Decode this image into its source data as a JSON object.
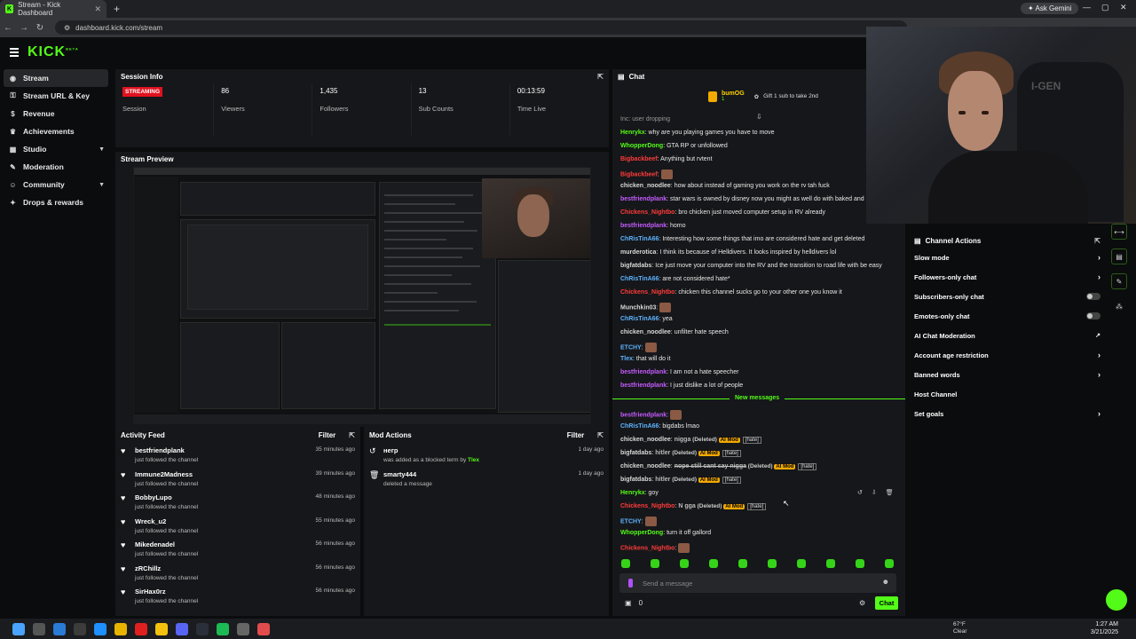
{
  "browser": {
    "tab_title": "Stream - Kick Dashboard",
    "url": "dashboard.kick.com/stream",
    "gemini": "Ask Gemini"
  },
  "brand": {
    "logo": "KICK",
    "beta": "BETA",
    "accent": "#53fc18"
  },
  "sidebar": {
    "items": [
      {
        "label": "Stream",
        "icon": "broadcast-icon"
      },
      {
        "label": "Stream URL & Key",
        "icon": "key-icon"
      },
      {
        "label": "Revenue",
        "icon": "dollar-icon"
      },
      {
        "label": "Achievements",
        "icon": "trophy-icon"
      },
      {
        "label": "Studio",
        "icon": "grid-icon"
      },
      {
        "label": "Moderation",
        "icon": "wrench-icon"
      },
      {
        "label": "Community",
        "icon": "people-icon"
      },
      {
        "label": "Drops & rewards",
        "icon": "gift-icon"
      }
    ]
  },
  "session": {
    "title": "Session Info",
    "status": "STREAMING",
    "stats": [
      {
        "value": "",
        "label": "Session"
      },
      {
        "value": "86",
        "label": "Viewers"
      },
      {
        "value": "1,435",
        "label": "Followers"
      },
      {
        "value": "13",
        "label": "Sub Counts"
      },
      {
        "value": "00:13:59",
        "label": "Time Live"
      }
    ]
  },
  "preview": {
    "title": "Stream Preview"
  },
  "activity": {
    "title": "Activity Feed",
    "filter": "Filter",
    "items": [
      {
        "name": "bestfriendplank",
        "sub": "just followed the channel",
        "time": "35 minutes ago"
      },
      {
        "name": "Immune2Madness",
        "sub": "just followed the channel",
        "time": "39 minutes ago"
      },
      {
        "name": "BobbyLupo",
        "sub": "just followed the channel",
        "time": "48 minutes ago"
      },
      {
        "name": "Wreck_u2",
        "sub": "just followed the channel",
        "time": "55 minutes ago"
      },
      {
        "name": "Mikedenadel",
        "sub": "just followed the channel",
        "time": "56 minutes ago"
      },
      {
        "name": "zRChillz",
        "sub": "just followed the channel",
        "time": "56 minutes ago"
      },
      {
        "name": "SirHax0rz",
        "sub": "just followed the channel",
        "time": "56 minutes ago"
      }
    ]
  },
  "mod": {
    "title": "Mod Actions",
    "filter": "Filter",
    "items": [
      {
        "name": "негр",
        "sub_pre": "was added as a blocked term by",
        "by": "Tlex",
        "time": "1 day ago"
      },
      {
        "name": "smarty444",
        "sub_pre": "deleted a message",
        "by": "",
        "time": "1 day ago"
      }
    ]
  },
  "chat": {
    "title": "Chat",
    "top_user": "bumOG",
    "top_count": "1",
    "gift": "Gift 1 sub to take 2nd",
    "partial": "Inc: user dropping",
    "messages": [
      {
        "user": "Henrykx",
        "cls": "u-g",
        "text": "why are you playing games you have to move"
      },
      {
        "user": "WhopperDong",
        "cls": "u-g",
        "text": "GTA RP or unfollowed"
      },
      {
        "user": "Bigbackbeef",
        "cls": "u-r",
        "text": "Anything but rvtent"
      },
      {
        "user": "Bigbackbeef",
        "cls": "u-r",
        "text": ""
      },
      {
        "user": "chicken_noodlee",
        "cls": "u-w",
        "text": "how about instead of gaming you work on the rv tah fuck"
      },
      {
        "user": "bestfriendplank",
        "cls": "u-p",
        "text": "star wars is owned by disney now you might as well do with baked and b"
      },
      {
        "user": "Chickens_Nightbo",
        "cls": "u-r",
        "text": "bro chicken just moved computer setup in RV already"
      },
      {
        "user": "bestfriendplank",
        "cls": "u-p",
        "text": "homo"
      },
      {
        "user": "ChRisTinA66",
        "cls": "u-b",
        "text": "Interesting how some things that imo are considered hate and get deleted"
      },
      {
        "user": "murderotica",
        "cls": "u-w",
        "text": "I think its because of Helldivers. It looks inspired by helldivers lol"
      },
      {
        "user": "bigfatdabs",
        "cls": "u-w",
        "text": "Ice just move your computer into the RV and the transition to road life with be easy"
      },
      {
        "user": "ChRisTinA66",
        "cls": "u-b",
        "text": "are not considered hate*"
      },
      {
        "user": "Chickens_Nightbo",
        "cls": "u-r",
        "text": "chicken this channel sucks go to your other one you know it"
      },
      {
        "user": "Munchkin03",
        "cls": "u-w",
        "text": ""
      },
      {
        "user": "ChRisTinA66",
        "cls": "u-b",
        "text": "yea"
      },
      {
        "user": "chicken_noodlee",
        "cls": "u-w",
        "text": "unfilter hate speech"
      },
      {
        "user": "ETCHY",
        "cls": "u-b",
        "text": ""
      },
      {
        "user": "Tlex",
        "cls": "u-b",
        "text": "that will do it"
      },
      {
        "user": "bestfriendplank",
        "cls": "u-p",
        "text": "I am not a hate speecher"
      },
      {
        "user": "bestfriendplank",
        "cls": "u-p",
        "text": "I just dislike a lot of people"
      }
    ],
    "new_label": "New messages",
    "new_messages": [
      {
        "user": "bestfriendplank",
        "cls": "u-p",
        "text": ""
      },
      {
        "user": "ChRisTinA66",
        "cls": "u-b",
        "text": "bigdabs lmao"
      },
      {
        "user": "chicken_noodlee",
        "cls": "u-w",
        "text": "nigga",
        "deleted": true
      },
      {
        "user": "bigfatdabs",
        "cls": "u-w",
        "text": "hitler",
        "deleted": true
      },
      {
        "user": "chicken_noodlee",
        "cls": "u-w",
        "text": "nope still cant say nigga",
        "deleted": true,
        "strike": true
      },
      {
        "user": "bigfatdabs",
        "cls": "u-w",
        "text": "hitler",
        "deleted": true
      },
      {
        "user": "Henrykx",
        "cls": "u-g",
        "text": "goy"
      },
      {
        "user": "Chickens_Nightbo",
        "cls": "u-r",
        "text": "N gga",
        "deleted": true
      },
      {
        "user": "ETCHY",
        "cls": "u-b",
        "text": ""
      },
      {
        "user": "WhopperDong",
        "cls": "u-g",
        "text": "turn it off gallord"
      },
      {
        "user": "Chickens_Nightbo",
        "cls": "u-r",
        "text": ""
      }
    ],
    "deleted_label": "(Deleted)",
    "aimod_label": "AI Mod",
    "hate_label": "[hate]",
    "input_placeholder": "Send a message",
    "send_label": "Chat",
    "count": "0"
  },
  "channel_actions": {
    "title": "Channel Actions",
    "items": [
      {
        "label": "Slow mode",
        "kind": "arrow"
      },
      {
        "label": "Followers-only chat",
        "kind": "arrow"
      },
      {
        "label": "Subscribers-only chat",
        "kind": "toggle"
      },
      {
        "label": "Emotes-only chat",
        "kind": "toggle"
      },
      {
        "label": "AI Chat Moderation",
        "kind": "external"
      },
      {
        "label": "Account age restriction",
        "kind": "arrow"
      },
      {
        "label": "Banned words",
        "kind": "arrow"
      },
      {
        "label": "Host Channel",
        "kind": "none"
      },
      {
        "label": "Set goals",
        "kind": "arrow"
      }
    ]
  },
  "webcam": {
    "shirt_text": "I-GEN"
  },
  "taskbar": {
    "temp": "67°F",
    "weather": "Clear",
    "time": "1:27 AM",
    "date": "3/21/2025"
  }
}
